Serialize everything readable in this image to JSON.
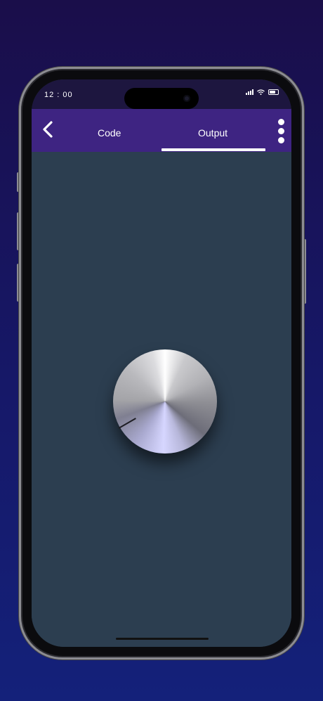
{
  "status_bar": {
    "time": "12 : 00"
  },
  "toolbar": {
    "back_icon": "chevron-left-icon",
    "tabs": [
      {
        "label": "Code",
        "active": false
      },
      {
        "label": "Output",
        "active": true
      }
    ],
    "more_icon": "more-vertical-icon"
  },
  "output": {
    "control": "rotary-knob"
  },
  "colors": {
    "background_top": "#1a0e4a",
    "background_bottom": "#14217a",
    "toolbar": "#3e2482",
    "status_bar": "#1d163f",
    "content": "#2c3e50",
    "tab_indicator": "#ffffff"
  }
}
